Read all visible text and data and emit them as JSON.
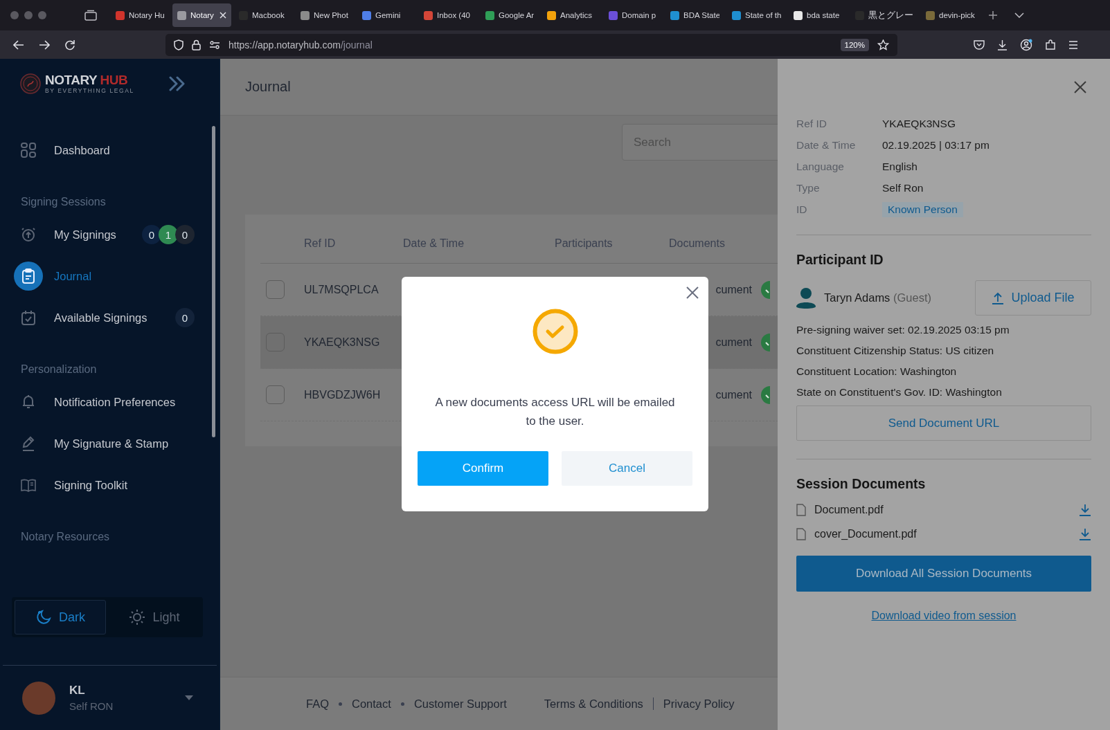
{
  "browser": {
    "tabs": [
      {
        "title": "Notary Hu",
        "selected": false,
        "color": "#d0342c"
      },
      {
        "title": "Notary",
        "selected": true,
        "color": "#9a9aa0"
      },
      {
        "title": "Macbook",
        "selected": false,
        "color": "#2a2a2a"
      },
      {
        "title": "New Phot",
        "selected": false,
        "color": "#8a8a8a"
      },
      {
        "title": "Gemini",
        "selected": false,
        "color": "#4f7fe8"
      },
      {
        "title": "Inbox (40",
        "selected": false,
        "color": "#d44638"
      },
      {
        "title": "Google Ar",
        "selected": false,
        "color": "#2f9e57"
      },
      {
        "title": "Analytics",
        "selected": false,
        "color": "#f2a20c"
      },
      {
        "title": "Domain p",
        "selected": false,
        "color": "#6b4fd8"
      },
      {
        "title": "BDA State",
        "selected": false,
        "color": "#1f8fd0"
      },
      {
        "title": "State of th",
        "selected": false,
        "color": "#1f8fd0"
      },
      {
        "title": "bda state",
        "selected": false,
        "color": "#e8e8e8"
      },
      {
        "title": "黒とグレー",
        "selected": false,
        "color": "#2a2a2a"
      },
      {
        "title": "devin-pick",
        "selected": false,
        "color": "#7a6a3a"
      }
    ],
    "url": {
      "host": "https://app.notaryhub.com",
      "path": "/journal"
    },
    "zoom": "120%"
  },
  "sidebar": {
    "logo": {
      "name": "NOTARY",
      "accent": "HUB",
      "tagline": "BY EVERYTHING LEGAL"
    },
    "items": [
      {
        "kind": "link",
        "label": "Dashboard",
        "selected": false
      },
      {
        "kind": "section",
        "label": "Signing Sessions"
      },
      {
        "kind": "link",
        "label": "My Signings",
        "selected": false,
        "badges": [
          {
            "text": "0",
            "color": "#0d2240"
          },
          {
            "text": "1",
            "color": "#2f8a52"
          },
          {
            "text": "0",
            "color": "#1e2530"
          }
        ]
      },
      {
        "kind": "link",
        "label": "Journal",
        "selected": true
      },
      {
        "kind": "link",
        "label": "Available Signings",
        "selected": false,
        "badges": [
          {
            "text": "0",
            "color": "#13233a"
          }
        ]
      },
      {
        "kind": "section",
        "label": "Personalization"
      },
      {
        "kind": "link",
        "label": "Notification Preferences",
        "selected": false
      },
      {
        "kind": "link",
        "label": "My Signature & Stamp",
        "selected": false
      },
      {
        "kind": "link",
        "label": "Signing Toolkit",
        "selected": false
      },
      {
        "kind": "section",
        "label": "Notary Resources"
      }
    ],
    "theme": [
      {
        "label": "Dark",
        "selected": true
      },
      {
        "label": "Light",
        "selected": false
      }
    ],
    "user": {
      "initials": "KL",
      "role": "Self RON"
    }
  },
  "main": {
    "title": "Journal",
    "search": {
      "placeholder": "Search"
    },
    "table": {
      "columns": [
        "Ref ID",
        "Date & Time",
        "Participants",
        "Documents"
      ],
      "rows": [
        {
          "ref_id": "UL7MSQPLCA",
          "documents": "cument",
          "selected": false,
          "checked": false
        },
        {
          "ref_id": "YKAEQK3NSG",
          "documents": "cument",
          "selected": true,
          "checked": false
        },
        {
          "ref_id": "HBVGDZJW6H",
          "documents": "cument",
          "selected": false,
          "checked": false
        }
      ]
    },
    "footer": {
      "links": [
        "FAQ",
        "Contact",
        "Customer Support"
      ],
      "legal": [
        "Terms & Conditions",
        "Privacy Policy"
      ]
    }
  },
  "modal": {
    "message": "A new documents access URL will be emailed to the user.",
    "buttons": [
      {
        "label": "Confirm",
        "kind": "primary"
      },
      {
        "label": "Cancel",
        "kind": "secondary"
      }
    ]
  },
  "details": {
    "fields": [
      {
        "label": "Ref ID",
        "value": "YKAEQK3NSG",
        "kind": "text"
      },
      {
        "label": "Date & Time",
        "value": "02.19.2025 | 03:17 pm",
        "kind": "text"
      },
      {
        "label": "Language",
        "value": "English",
        "kind": "text"
      },
      {
        "label": "Type",
        "value": "Self Ron",
        "kind": "text"
      },
      {
        "label": "ID",
        "value": "Known Person",
        "kind": "tag"
      }
    ],
    "participant_heading": "Participant ID",
    "participant": {
      "name": "Taryn Adams",
      "role": "(Guest)"
    },
    "upload_button": "Upload File",
    "info_lines": [
      "Pre-signing waiver set: 02.19.2025 03:15 pm",
      "Constituent Citizenship Status: US citizen",
      "Constituent Location: Washington",
      "State on Constituent's Gov. ID: Washington"
    ],
    "send_button": "Send Document URL",
    "documents_heading": "Session Documents",
    "documents": [
      "Document.pdf",
      "cover_Document.pdf"
    ],
    "download_all_button": "Download All Session Documents",
    "video_link": "Download video from session"
  }
}
